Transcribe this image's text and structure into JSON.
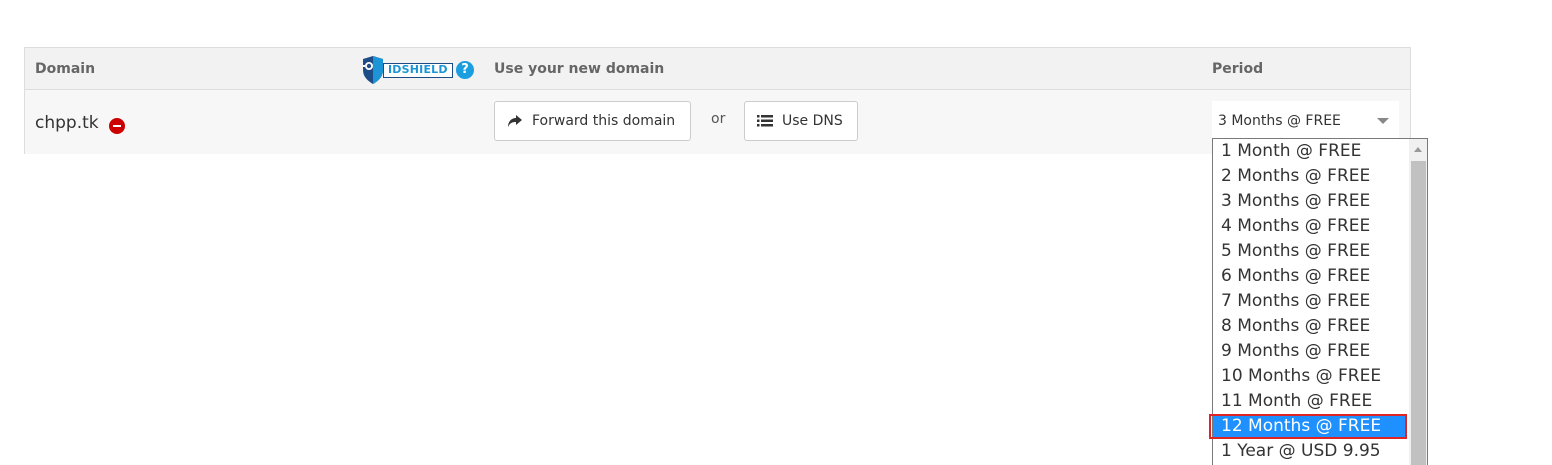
{
  "table": {
    "headers": {
      "domain": "Domain",
      "use": "Use your new domain",
      "period": "Period"
    },
    "idshield_label": "IDSHIELD",
    "help_glyph": "?",
    "row": {
      "domain": "chpp.tk",
      "forward_label": "Forward this domain",
      "or_text": "or",
      "dns_label": "Use DNS",
      "period_selected": "3 Months @ FREE"
    }
  },
  "dropdown": {
    "options": [
      "1 Month @ FREE",
      "2 Months @ FREE",
      "3 Months @ FREE",
      "4 Months @ FREE",
      "5 Months @ FREE",
      "6 Months @ FREE",
      "7 Months @ FREE",
      "8 Months @ FREE",
      "9 Months @ FREE",
      "10 Months @ FREE",
      "11 Month @ FREE",
      "12 Months @ FREE",
      "1 Year @ USD 9.95"
    ],
    "highlighted_index": 11
  },
  "colors": {
    "accent": "#1e90ff",
    "remove": "#cc0000",
    "highlight_border": "#e02424",
    "brand": "#1b95d6"
  },
  "icons": {
    "remove": "remove-icon",
    "forward": "share-arrow-icon",
    "dns": "list-icon",
    "help": "help-icon",
    "dropdown": "chevron-down-icon"
  }
}
